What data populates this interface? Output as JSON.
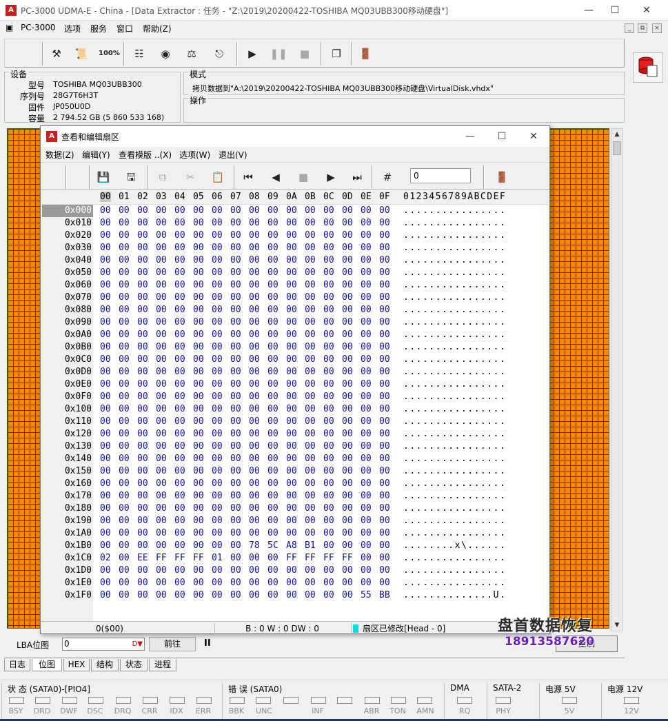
{
  "window": {
    "title": "PC-3000 UDMA-E - China - [Data Extractor : 任务 - \"Z:\\2019\\20200422-TOSHIBA MQ03UBB300移动硬盘\"]",
    "icon_label": "A",
    "minimize": "—",
    "maximize": "☐",
    "close": "✕"
  },
  "menu": {
    "app_label": "PC-3000",
    "items": [
      "选项",
      "服务",
      "窗口",
      "帮助(Z)"
    ]
  },
  "toolbar": {
    "icons": [
      "tools-icon",
      "script-icon",
      "percent-icon",
      "tree-icon",
      "binoculars-icon",
      "scale-icon",
      "drive-arrow-icon",
      "play-icon",
      "pause-icon",
      "stop-icon",
      "windows-icon",
      "exit-icon"
    ]
  },
  "device": {
    "title": "设备",
    "model_label": "型号",
    "model": "TOSHIBA MQ03UBB300",
    "serial_label": "序列号",
    "serial": "28G7T6H3T",
    "firmware_label": "固件",
    "firmware": "JP050U0D",
    "capacity_label": "容量",
    "capacity": "2 794.52 GB (5 860 533 168)"
  },
  "mode": {
    "title": "模式",
    "text": "拷贝数据到\"A:\\2019\\20200422-TOSHIBA MQ03UBB300移动硬盘\\VirtualDisk.vhdx\""
  },
  "operation": {
    "title": "操作"
  },
  "hex_window": {
    "title": "查看和编辑扇区",
    "minimize": "—",
    "maximize": "☐",
    "close": "✕",
    "menu": [
      "数据(Z)",
      "编辑(Y)",
      "查看模版 ..(X)",
      "选项(W)",
      "退出(V)"
    ],
    "sector_input": "0",
    "columns": [
      "00",
      "01",
      "02",
      "03",
      "04",
      "05",
      "06",
      "07",
      "08",
      "09",
      "0A",
      "0B",
      "0C",
      "0D",
      "0E",
      "0F"
    ],
    "ascii_header": "0123456789ABCDEF",
    "rows": [
      {
        "addr": "0x000",
        "bytes": [
          "00",
          "00",
          "00",
          "00",
          "00",
          "00",
          "00",
          "00",
          "00",
          "00",
          "00",
          "00",
          "00",
          "00",
          "00",
          "00"
        ],
        "ascii": "................"
      },
      {
        "addr": "0x010",
        "bytes": [
          "00",
          "00",
          "00",
          "00",
          "00",
          "00",
          "00",
          "00",
          "00",
          "00",
          "00",
          "00",
          "00",
          "00",
          "00",
          "00"
        ],
        "ascii": "................"
      },
      {
        "addr": "0x020",
        "bytes": [
          "00",
          "00",
          "00",
          "00",
          "00",
          "00",
          "00",
          "00",
          "00",
          "00",
          "00",
          "00",
          "00",
          "00",
          "00",
          "00"
        ],
        "ascii": "................"
      },
      {
        "addr": "0x030",
        "bytes": [
          "00",
          "00",
          "00",
          "00",
          "00",
          "00",
          "00",
          "00",
          "00",
          "00",
          "00",
          "00",
          "00",
          "00",
          "00",
          "00"
        ],
        "ascii": "................"
      },
      {
        "addr": "0x040",
        "bytes": [
          "00",
          "00",
          "00",
          "00",
          "00",
          "00",
          "00",
          "00",
          "00",
          "00",
          "00",
          "00",
          "00",
          "00",
          "00",
          "00"
        ],
        "ascii": "................"
      },
      {
        "addr": "0x050",
        "bytes": [
          "00",
          "00",
          "00",
          "00",
          "00",
          "00",
          "00",
          "00",
          "00",
          "00",
          "00",
          "00",
          "00",
          "00",
          "00",
          "00"
        ],
        "ascii": "................"
      },
      {
        "addr": "0x060",
        "bytes": [
          "00",
          "00",
          "00",
          "00",
          "00",
          "00",
          "00",
          "00",
          "00",
          "00",
          "00",
          "00",
          "00",
          "00",
          "00",
          "00"
        ],
        "ascii": "................"
      },
      {
        "addr": "0x070",
        "bytes": [
          "00",
          "00",
          "00",
          "00",
          "00",
          "00",
          "00",
          "00",
          "00",
          "00",
          "00",
          "00",
          "00",
          "00",
          "00",
          "00"
        ],
        "ascii": "................"
      },
      {
        "addr": "0x080",
        "bytes": [
          "00",
          "00",
          "00",
          "00",
          "00",
          "00",
          "00",
          "00",
          "00",
          "00",
          "00",
          "00",
          "00",
          "00",
          "00",
          "00"
        ],
        "ascii": "................"
      },
      {
        "addr": "0x090",
        "bytes": [
          "00",
          "00",
          "00",
          "00",
          "00",
          "00",
          "00",
          "00",
          "00",
          "00",
          "00",
          "00",
          "00",
          "00",
          "00",
          "00"
        ],
        "ascii": "................"
      },
      {
        "addr": "0x0A0",
        "bytes": [
          "00",
          "00",
          "00",
          "00",
          "00",
          "00",
          "00",
          "00",
          "00",
          "00",
          "00",
          "00",
          "00",
          "00",
          "00",
          "00"
        ],
        "ascii": "................"
      },
      {
        "addr": "0x0B0",
        "bytes": [
          "00",
          "00",
          "00",
          "00",
          "00",
          "00",
          "00",
          "00",
          "00",
          "00",
          "00",
          "00",
          "00",
          "00",
          "00",
          "00"
        ],
        "ascii": "................"
      },
      {
        "addr": "0x0C0",
        "bytes": [
          "00",
          "00",
          "00",
          "00",
          "00",
          "00",
          "00",
          "00",
          "00",
          "00",
          "00",
          "00",
          "00",
          "00",
          "00",
          "00"
        ],
        "ascii": "................"
      },
      {
        "addr": "0x0D0",
        "bytes": [
          "00",
          "00",
          "00",
          "00",
          "00",
          "00",
          "00",
          "00",
          "00",
          "00",
          "00",
          "00",
          "00",
          "00",
          "00",
          "00"
        ],
        "ascii": "................"
      },
      {
        "addr": "0x0E0",
        "bytes": [
          "00",
          "00",
          "00",
          "00",
          "00",
          "00",
          "00",
          "00",
          "00",
          "00",
          "00",
          "00",
          "00",
          "00",
          "00",
          "00"
        ],
        "ascii": "................"
      },
      {
        "addr": "0x0F0",
        "bytes": [
          "00",
          "00",
          "00",
          "00",
          "00",
          "00",
          "00",
          "00",
          "00",
          "00",
          "00",
          "00",
          "00",
          "00",
          "00",
          "00"
        ],
        "ascii": "................"
      },
      {
        "addr": "0x100",
        "bytes": [
          "00",
          "00",
          "00",
          "00",
          "00",
          "00",
          "00",
          "00",
          "00",
          "00",
          "00",
          "00",
          "00",
          "00",
          "00",
          "00"
        ],
        "ascii": "................"
      },
      {
        "addr": "0x110",
        "bytes": [
          "00",
          "00",
          "00",
          "00",
          "00",
          "00",
          "00",
          "00",
          "00",
          "00",
          "00",
          "00",
          "00",
          "00",
          "00",
          "00"
        ],
        "ascii": "................"
      },
      {
        "addr": "0x120",
        "bytes": [
          "00",
          "00",
          "00",
          "00",
          "00",
          "00",
          "00",
          "00",
          "00",
          "00",
          "00",
          "00",
          "00",
          "00",
          "00",
          "00"
        ],
        "ascii": "................"
      },
      {
        "addr": "0x130",
        "bytes": [
          "00",
          "00",
          "00",
          "00",
          "00",
          "00",
          "00",
          "00",
          "00",
          "00",
          "00",
          "00",
          "00",
          "00",
          "00",
          "00"
        ],
        "ascii": "................"
      },
      {
        "addr": "0x140",
        "bytes": [
          "00",
          "00",
          "00",
          "00",
          "00",
          "00",
          "00",
          "00",
          "00",
          "00",
          "00",
          "00",
          "00",
          "00",
          "00",
          "00"
        ],
        "ascii": "................"
      },
      {
        "addr": "0x150",
        "bytes": [
          "00",
          "00",
          "00",
          "00",
          "00",
          "00",
          "00",
          "00",
          "00",
          "00",
          "00",
          "00",
          "00",
          "00",
          "00",
          "00"
        ],
        "ascii": "................"
      },
      {
        "addr": "0x160",
        "bytes": [
          "00",
          "00",
          "00",
          "00",
          "00",
          "00",
          "00",
          "00",
          "00",
          "00",
          "00",
          "00",
          "00",
          "00",
          "00",
          "00"
        ],
        "ascii": "................"
      },
      {
        "addr": "0x170",
        "bytes": [
          "00",
          "00",
          "00",
          "00",
          "00",
          "00",
          "00",
          "00",
          "00",
          "00",
          "00",
          "00",
          "00",
          "00",
          "00",
          "00"
        ],
        "ascii": "................"
      },
      {
        "addr": "0x180",
        "bytes": [
          "00",
          "00",
          "00",
          "00",
          "00",
          "00",
          "00",
          "00",
          "00",
          "00",
          "00",
          "00",
          "00",
          "00",
          "00",
          "00"
        ],
        "ascii": "................"
      },
      {
        "addr": "0x190",
        "bytes": [
          "00",
          "00",
          "00",
          "00",
          "00",
          "00",
          "00",
          "00",
          "00",
          "00",
          "00",
          "00",
          "00",
          "00",
          "00",
          "00"
        ],
        "ascii": "................"
      },
      {
        "addr": "0x1A0",
        "bytes": [
          "00",
          "00",
          "00",
          "00",
          "00",
          "00",
          "00",
          "00",
          "00",
          "00",
          "00",
          "00",
          "00",
          "00",
          "00",
          "00"
        ],
        "ascii": "................"
      },
      {
        "addr": "0x1B0",
        "bytes": [
          "00",
          "00",
          "00",
          "00",
          "00",
          "00",
          "00",
          "00",
          "78",
          "5C",
          "A8",
          "B1",
          "00",
          "00",
          "00",
          "00"
        ],
        "ascii": "........x\\......"
      },
      {
        "addr": "0x1C0",
        "bytes": [
          "02",
          "00",
          "EE",
          "FF",
          "FF",
          "FF",
          "01",
          "00",
          "00",
          "00",
          "FF",
          "FF",
          "FF",
          "FF",
          "00",
          "00"
        ],
        "ascii": "................"
      },
      {
        "addr": "0x1D0",
        "bytes": [
          "00",
          "00",
          "00",
          "00",
          "00",
          "00",
          "00",
          "00",
          "00",
          "00",
          "00",
          "00",
          "00",
          "00",
          "00",
          "00"
        ],
        "ascii": "................"
      },
      {
        "addr": "0x1E0",
        "bytes": [
          "00",
          "00",
          "00",
          "00",
          "00",
          "00",
          "00",
          "00",
          "00",
          "00",
          "00",
          "00",
          "00",
          "00",
          "00",
          "00"
        ],
        "ascii": "................"
      },
      {
        "addr": "0x1F0",
        "bytes": [
          "00",
          "00",
          "00",
          "00",
          "00",
          "00",
          "00",
          "00",
          "00",
          "00",
          "00",
          "00",
          "00",
          "00",
          "55",
          "BB"
        ],
        "ascii": "..............U."
      }
    ],
    "status": {
      "offset": "0($00)",
      "bwdw": "B : 0 W : 0 DW : 0",
      "modified": "扇区已修改[Head - 0]"
    }
  },
  "lba": {
    "label": "LBA位图",
    "value": "0",
    "go_button": "前往",
    "pause": "II",
    "right_button": "复制"
  },
  "tabs": [
    "日志",
    "位图",
    "HEX",
    "结构",
    "状态",
    "进程"
  ],
  "status_strip": {
    "status_title": "状 态 (SATA0)-[PIO4]",
    "status_leds": [
      "BSY",
      "DRD",
      "DWF",
      "DSC",
      "DRQ",
      "CRR",
      "IDX",
      "ERR"
    ],
    "error_title": "错 误 (SATA0)",
    "error_leds": [
      "BBK",
      "UNC",
      "",
      "INF",
      "",
      "ABR",
      "TON",
      "AMN"
    ],
    "dma_title": "DMA",
    "dma_leds": [
      "RQ"
    ],
    "sata_title": "SATA-2",
    "sata_leds": [
      "PHY"
    ],
    "p5_title": "电源 5V",
    "p5_leds": [
      "5V"
    ],
    "p12_title": "电源 12V",
    "p12_leds": [
      "12V"
    ]
  },
  "watermark": {
    "line1": "盘首数据恢复",
    "line2": "18913587620"
  }
}
